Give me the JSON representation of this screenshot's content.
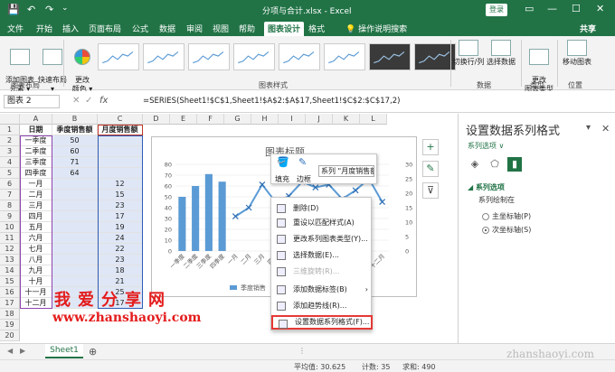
{
  "titlebar": {
    "title": "分项与合计.xlsx  -  Excel",
    "login_label": "登录",
    "qa_save": "💾",
    "qa_undo": "↶",
    "qa_redo": "↷",
    "qa_more": "⌄",
    "ribbon_display": "▭",
    "minimize": "—",
    "restore": "☐",
    "close": "✕"
  },
  "tabs": [
    {
      "label": "文件"
    },
    {
      "label": "开始"
    },
    {
      "label": "插入"
    },
    {
      "label": "页面布局"
    },
    {
      "label": "公式"
    },
    {
      "label": "数据"
    },
    {
      "label": "审阅"
    },
    {
      "label": "视图"
    },
    {
      "label": "帮助"
    },
    {
      "label": "图表设计"
    },
    {
      "label": "格式"
    },
    {
      "label": "💡 操作说明搜索"
    }
  ],
  "share_label": "共享",
  "ribbon": {
    "add_element": "添加图表\n元素 ▾",
    "quick_layout": "快速布局\n▾",
    "change_color": "更改\n颜色 ▾",
    "switch_rowcol": "切换行/列",
    "select_data": "选择数据",
    "change_type": "更改\n图表类型",
    "move_chart": "移动图表",
    "group_layout": "图表布局",
    "group_styles": "图表样式",
    "group_data": "数据",
    "group_type": "类型",
    "group_location": "位置"
  },
  "formula_bar": {
    "name_box": "图表 2",
    "cancel": "✕",
    "enter": "✓",
    "fx": "fx",
    "formula": "=SERIES(Sheet1!$C$1,Sheet1!$A$2:$A$17,Sheet1!$C$2:$C$17,2)"
  },
  "grid": {
    "columns": [
      "A",
      "B",
      "C",
      "D",
      "E",
      "F",
      "G",
      "H",
      "I",
      "J",
      "K",
      "L"
    ],
    "rows": [
      "1",
      "2",
      "3",
      "4",
      "5",
      "6",
      "7",
      "8",
      "9",
      "10",
      "11",
      "12",
      "13",
      "14",
      "15",
      "16",
      "17",
      "18",
      "19",
      "20"
    ],
    "headers": [
      "日期",
      "季度销售额",
      "月度销售额"
    ],
    "data": [
      [
        "一季度",
        "50",
        ""
      ],
      [
        "二季度",
        "60",
        ""
      ],
      [
        "三季度",
        "71",
        ""
      ],
      [
        "四季度",
        "64",
        ""
      ],
      [
        "一月",
        "",
        "12"
      ],
      [
        "二月",
        "",
        "15"
      ],
      [
        "三月",
        "",
        "23"
      ],
      [
        "四月",
        "",
        "17"
      ],
      [
        "五月",
        "",
        "19"
      ],
      [
        "六月",
        "",
        "24"
      ],
      [
        "七月",
        "",
        "22"
      ],
      [
        "八月",
        "",
        "23"
      ],
      [
        "九月",
        "",
        "18"
      ],
      [
        "十月",
        "",
        "21"
      ],
      [
        "十一月",
        "",
        "25"
      ],
      [
        "十二月",
        "",
        "17"
      ]
    ]
  },
  "chart_data": {
    "type": "bar",
    "title": "图表标题",
    "categories": [
      "一季度",
      "二季度",
      "三季度",
      "四季度",
      "一月",
      "二月",
      "三月",
      "四月",
      "五月",
      "六月",
      "七月",
      "八月",
      "九月",
      "十月",
      "十一月",
      "十二月"
    ],
    "series": [
      {
        "name": "季度销售额",
        "type": "bar",
        "axis": "primary",
        "values": [
          50,
          60,
          71,
          64,
          null,
          null,
          null,
          null,
          null,
          null,
          null,
          null,
          null,
          null,
          null,
          null
        ]
      },
      {
        "name": "月度销售额",
        "type": "line",
        "axis": "secondary",
        "values": [
          null,
          null,
          null,
          null,
          12,
          15,
          23,
          17,
          19,
          24,
          22,
          23,
          18,
          21,
          25,
          17
        ]
      }
    ],
    "primary_ticks": [
      "0",
      "10",
      "20",
      "30",
      "40",
      "50",
      "60",
      "70",
      "80"
    ],
    "secondary_ticks": [
      "0",
      "5",
      "10",
      "15",
      "20",
      "25",
      "30"
    ],
    "ylim": [
      0,
      80
    ],
    "y2lim": [
      0,
      30
    ],
    "legend_label": "季度销售",
    "legend_position": "bottom",
    "grid": true,
    "colors": {
      "bar": "#5b9bd5",
      "line": "#5b9bd5"
    }
  },
  "chart_buttons": {
    "add": "+",
    "style": "✎",
    "filter": "⊽"
  },
  "mini_toolbar": {
    "fill_label": "填充",
    "border_label": "边框",
    "series_selector": "系列 \"月度销售额\" ▾"
  },
  "context_menu": [
    {
      "label": "删除(D)",
      "disabled": false,
      "submenu": false
    },
    {
      "label": "重设以匹配样式(A)",
      "disabled": false,
      "submenu": false
    },
    {
      "label": "更改系列图表类型(Y)...",
      "disabled": false,
      "submenu": false
    },
    {
      "label": "选择数据(E)...",
      "disabled": false,
      "submenu": false
    },
    {
      "label": "三维旋转(R)...",
      "disabled": true,
      "submenu": false
    },
    {
      "label": "添加数据标签(B)",
      "disabled": false,
      "submenu": true
    },
    {
      "label": "添加趋势线(R)...",
      "disabled": false,
      "submenu": false
    },
    {
      "label": "设置数据系列格式(F)...",
      "disabled": false,
      "submenu": false,
      "highlight": true
    }
  ],
  "pane": {
    "title": "设置数据系列格式",
    "options_label": "系列选项 ∨",
    "section": "◢ 系列选项",
    "plot_on_label": "系列绘制在",
    "primary_axis": "主坐标轴(P)",
    "secondary_axis": "次坐标轴(S)",
    "selected": "secondary",
    "collapse": "▾",
    "close": "✕"
  },
  "watermark": {
    "line1": "我爱分享网",
    "line2": "www.zhanshaoyi.com",
    "corner": "zhanshaoyi.com"
  },
  "sheet_tabs": {
    "sheet": "Sheet1",
    "add": "⊕",
    "nav_prev": "◀",
    "nav_next": "▶",
    "more": "⋮"
  },
  "status": {
    "average": "平均值: 30.625",
    "count": "计数: 35",
    "sum": "求和: 490"
  }
}
